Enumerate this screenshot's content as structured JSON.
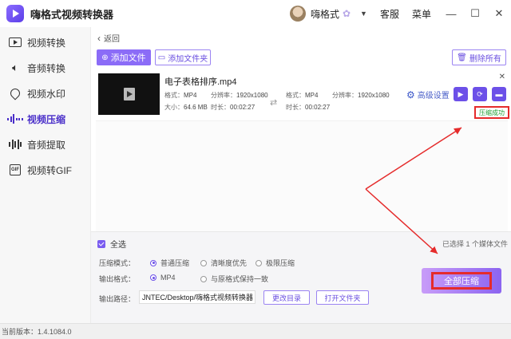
{
  "app": {
    "title": "嗨格式视频转换器"
  },
  "header": {
    "username": "嗨格式",
    "customer_service": "客服",
    "menu": "菜单",
    "minimize": "—",
    "maximize": "☐",
    "close": "✕"
  },
  "sidebar": {
    "items": [
      {
        "label": "视频转换",
        "icon": "video-icon"
      },
      {
        "label": "音频转换",
        "icon": "speaker-icon"
      },
      {
        "label": "视频水印",
        "icon": "watermark-icon"
      },
      {
        "label": "视频压缩",
        "icon": "compress-bars-icon",
        "active": true
      },
      {
        "label": "音频提取",
        "icon": "audio-wave-icon"
      },
      {
        "label": "视频转GIF",
        "icon": "gif-icon"
      }
    ]
  },
  "toolbar": {
    "back": "返回",
    "add_file": "添加文件",
    "add_folder": "添加文件夹",
    "delete_all": "删除所有"
  },
  "file": {
    "name": "电子表格排序.mp4",
    "source": {
      "format_label": "格式：",
      "format": "MP4",
      "resolution_label": "分辨率：",
      "resolution": "1920x1080",
      "size_label": "大小：",
      "size": "64.6 MB",
      "duration_label": "时长：",
      "duration": "00:02:27"
    },
    "output": {
      "format_label": "格式：",
      "format": "MP4",
      "resolution_label": "分辨率：",
      "resolution": "1920x1080",
      "duration_label": "时长：",
      "duration": "00:02:27"
    },
    "advanced_settings": "高级设置",
    "status": "压缩成功"
  },
  "bottom": {
    "select_all": "全选",
    "selected_info": "已选择 1 个媒体文件",
    "compress_mode_label": "压缩模式：",
    "compress_modes": [
      "普通压缩",
      "清晰度优先",
      "极限压缩"
    ],
    "output_format_label": "输出格式：",
    "output_formats": [
      "MP4",
      "与原格式保持一致"
    ],
    "output_path_label": "输出路径：",
    "output_path": "JNTEC/Desktop/嗨格式视频转换器",
    "change_dir": "更改目录",
    "open_folder": "打开文件夹",
    "compress_all": "全部压缩"
  },
  "status_bar": {
    "version": "当前版本：1.4.1084.0"
  },
  "colors": {
    "accent": "#6c50e8",
    "highlight": "#e52b2b",
    "success": "#1d9d2f"
  }
}
